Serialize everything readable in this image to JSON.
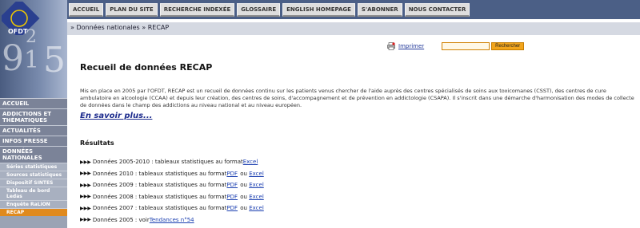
{
  "logo": {
    "text": "OFDT",
    "digits": [
      "9",
      "2",
      "1",
      "5"
    ]
  },
  "nav": {
    "tabs": [
      "ACCUEIL",
      "PLAN DU SITE",
      "RECHERCHE INDEXÉE",
      "GLOSSAIRE",
      "ENGLISH HOMEPAGE",
      "S'ABONNER",
      "NOUS CONTACTER"
    ]
  },
  "breadcrumb": {
    "prefix": "»",
    "parent": "Données nationales",
    "separator": "»",
    "current": "RECAP"
  },
  "sidebar": {
    "items": [
      {
        "label": "ACCUEIL",
        "type": "main"
      },
      {
        "label": "ADDICTIONS ET THÉMATIQUES",
        "type": "main"
      },
      {
        "label": "ACTUALITÉS",
        "type": "main"
      },
      {
        "label": "INFOS PRESSE",
        "type": "main"
      },
      {
        "label": "DONNÉES NATIONALES",
        "type": "main"
      },
      {
        "label": "Séries statistiques",
        "type": "sub"
      },
      {
        "label": "Sources statistiques",
        "type": "sub"
      },
      {
        "label": "Dispositif SINTES",
        "type": "sub"
      },
      {
        "label": "Tableau de bord Ledas",
        "type": "sub"
      },
      {
        "label": "Enquête RaLiON",
        "type": "sub"
      },
      {
        "label": "RECAP",
        "type": "sub",
        "active": true
      }
    ]
  },
  "tools": {
    "print_label": "Imprimer",
    "search_value": "",
    "search_button": "Rechercher"
  },
  "main": {
    "title": "Recueil de données RECAP",
    "intro": "Mis en place en 2005 par l'OFDT, RECAP est un recueil de données continu sur les patients venus chercher de l'aide auprès des centres spécialisés de soins aux toxicomanes (CSST), des centres de cure ambulatoire en alcoologie (CCAA) et depuis leur création, des centres de soins, d'accompagnement et de prévention en addictologie (CSAPA). Il s'inscrit dans une démarche d'harmonisation des modes de collecte de données dans le champ des addictions au niveau national et au niveau européen.",
    "more_link": "En savoir plus...",
    "results_title": "Résultats",
    "results": [
      {
        "arrows": "▶▶▶",
        "text": "Données 2005-2010 : tableaux statistiques au format ",
        "pdf": "",
        "sep": "",
        "excel": "Excel"
      },
      {
        "arrows": "▶▶▶",
        "text": "Données 2010 : tableaux statistiques au format ",
        "pdf": "PDF",
        "sep": " ou ",
        "excel": "Excel"
      },
      {
        "arrows": "▶▶▶",
        "text": "Données 2009 : tableaux statistiques au format ",
        "pdf": "PDF",
        "sep": " ou ",
        "excel": "Excel"
      },
      {
        "arrows": "▶▶▶",
        "text": "Données 2008 : tableaux statistiques au format ",
        "pdf": "PDF",
        "sep": " ou ",
        "excel": "Excel"
      },
      {
        "arrows": "▶▶▶",
        "text": "Données 2007 : tableaux statistiques au format ",
        "pdf": "PDF",
        "sep": " ou ",
        "excel": "Excel"
      },
      {
        "arrows": "▶▶▶",
        "text": "Données 2005 : voir ",
        "pdf": "",
        "sep": "",
        "excel": "Tendances n°54"
      }
    ]
  }
}
